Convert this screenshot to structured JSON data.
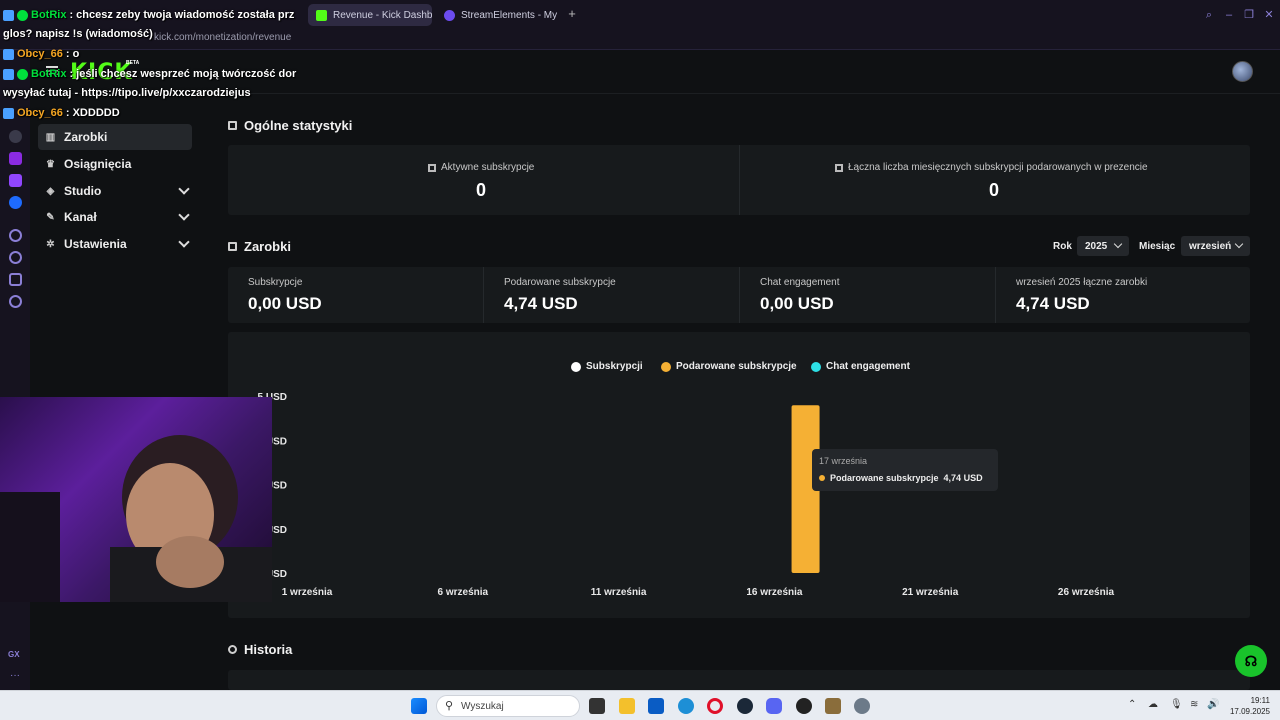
{
  "browser": {
    "tabs": [
      {
        "label": "Revenue - Kick Dashboar",
        "active": true
      },
      {
        "label": "StreamElements - My das",
        "active": false
      }
    ],
    "url": "kick.com/monetization/revenue"
  },
  "kick": {
    "logo": "KICK",
    "beta": "BETA"
  },
  "nav": {
    "items": [
      {
        "label": "Zarobki",
        "icon": "chart-icon",
        "active": true
      },
      {
        "label": "Osiągnięcia",
        "icon": "trophy-icon"
      },
      {
        "label": "Studio",
        "icon": "studio-icon",
        "expandable": true
      },
      {
        "label": "Kanał",
        "icon": "channel-icon",
        "expandable": true
      },
      {
        "label": "Ustawienia",
        "icon": "gear-icon",
        "expandable": true
      }
    ]
  },
  "overview": {
    "title": "Ogólne statystyki",
    "stats": [
      {
        "label": "Aktywne subskrypcje",
        "value": "0"
      },
      {
        "label": "Łączna liczba miesięcznych subskrypcji podarowanych w prezencie",
        "value": "0"
      }
    ]
  },
  "earnings": {
    "title": "Zarobki",
    "year_label": "Rok",
    "year_value": "2025",
    "month_label": "Miesiąc",
    "month_value": "wrzesień",
    "cards": [
      {
        "label": "Subskrypcje",
        "value": "0,00 USD"
      },
      {
        "label": "Podarowane subskrypcje",
        "value": "4,74 USD"
      },
      {
        "label": "Chat engagement",
        "value": "0,00 USD"
      },
      {
        "label": "wrzesień 2025 łączne zarobki",
        "value": "4,74 USD"
      }
    ]
  },
  "chart_data": {
    "type": "bar",
    "series": [
      {
        "name": "Subskrypcji",
        "color": "#ffffff",
        "points": []
      },
      {
        "name": "Podarowane subskrypcje",
        "color": "#f5b034",
        "points": [
          {
            "x": "17 września",
            "y": 4.74
          }
        ]
      },
      {
        "name": "Chat engagement",
        "color": "#2de0e6",
        "points": []
      }
    ],
    "x_ticks": [
      "1 września",
      "6 września",
      "11 września",
      "16 września",
      "21 września",
      "26 września"
    ],
    "x_range": [
      1,
      30
    ],
    "y_ticks": [
      "5 USD",
      "USD",
      "USD",
      "USD",
      "USD"
    ],
    "ylim": [
      0,
      5
    ],
    "tooltip": {
      "title": "17 września",
      "series": "Podarowane subskrypcje",
      "value": "4,74 USD"
    }
  },
  "history": {
    "title": "Historia"
  },
  "chat": {
    "lines": [
      {
        "user": "BotRix",
        "color": "#00e03c",
        "text": ": chcesz zeby twoja wiadomość została prz"
      },
      {
        "user": "",
        "color": "#ffffff",
        "text": "glos? napisz !s (wiadomość)"
      },
      {
        "user": "Obcy_66",
        "color": "#f5a623",
        "text": ": o"
      },
      {
        "user": "BotRix",
        "color": "#00e03c",
        "text": ": jeśli chcesz wesprzeć moją twórczość dor"
      },
      {
        "user": "",
        "color": "#ffffff",
        "text": "wysyłać tutaj - https://tipo.live/p/xxczarodziejus"
      },
      {
        "user": "Obcy_66",
        "color": "#f5a623",
        "text": ": XDDDDD"
      }
    ]
  },
  "taskbar": {
    "search_placeholder": "Wyszukaj",
    "time": "19:11",
    "date": "17.09.2025"
  },
  "opera": {
    "gx_label": "GX"
  }
}
